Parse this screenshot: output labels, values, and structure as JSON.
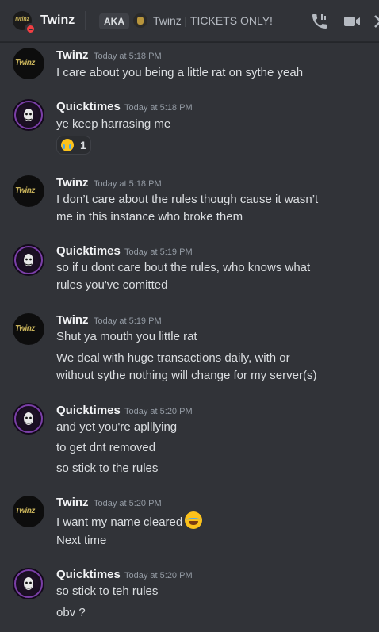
{
  "header": {
    "name": "Twinz",
    "avatar_text": "Twinz",
    "status": "do-not-disturb",
    "aka_label": "AKA",
    "other_name": "Twinz | TICKETS ONLY!",
    "icons": [
      "call-icon",
      "video-icon",
      "close-icon"
    ]
  },
  "colors": {
    "background": "#313338",
    "text": "#dbdee1",
    "username": "#f2f3f5",
    "timestamp": "#949ba4",
    "dnd": "#f23f43"
  },
  "messages": [
    {
      "author": "Twinz",
      "avatar_text": "Twinz",
      "timestamp": "Today at 5:18 PM",
      "lines": [
        "I care about you being a little rat on sythe yeah"
      ]
    },
    {
      "author": "Quicktimes",
      "timestamp": "Today at 5:18 PM",
      "lines": [
        "ye keep harrasing me"
      ],
      "reaction": {
        "emoji": "crying-face",
        "count": "1"
      }
    },
    {
      "author": "Twinz",
      "avatar_text": "Twinz",
      "timestamp": "Today at 5:18 PM",
      "lines": [
        "I don’t care about the rules though cause it wasn’t",
        "me in this instance who broke them"
      ]
    },
    {
      "author": "Quicktimes",
      "timestamp": "Today at 5:19 PM",
      "lines": [
        "so if u dont care bout the rules, who knows what",
        "rules you've comitted"
      ]
    },
    {
      "author": "Twinz",
      "avatar_text": "Twinz",
      "timestamp": "Today at 5:19 PM",
      "lines": [
        "Shut ya mouth you little rat",
        "We deal with huge transactions daily, with or",
        "without sythe nothing will change for my server(s)"
      ]
    },
    {
      "author": "Quicktimes",
      "timestamp": "Today at 5:20 PM",
      "lines": [
        "and yet you're aplllying",
        "to get dnt removed",
        "so stick to the rules"
      ]
    },
    {
      "author": "Twinz",
      "avatar_text": "Twinz",
      "timestamp": "Today at 5:20 PM",
      "lines": [
        "I want my name cleared",
        "Next time"
      ],
      "inline_emoji": "joy-face"
    },
    {
      "author": "Quicktimes",
      "timestamp": "Today at 5:20 PM",
      "lines": [
        "so stick to teh rules",
        "obv ?"
      ]
    }
  ]
}
